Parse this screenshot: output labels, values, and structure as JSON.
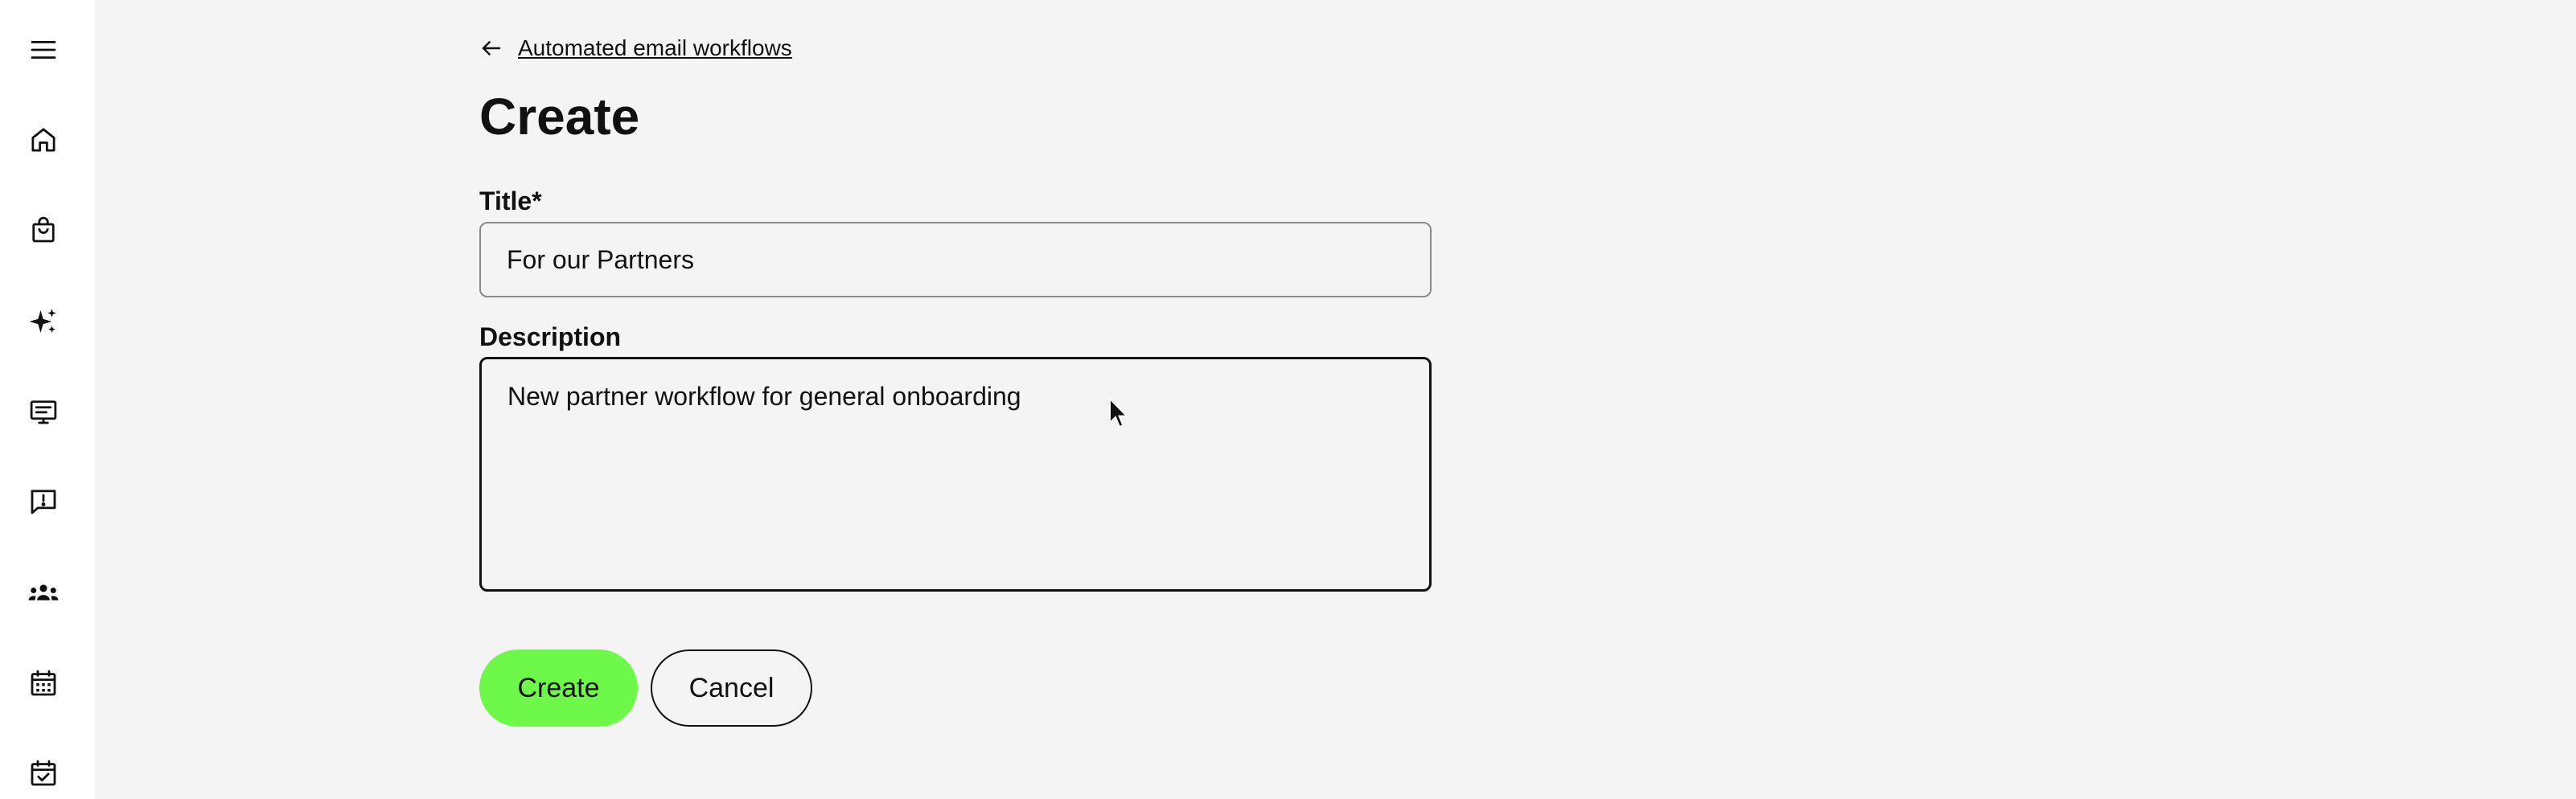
{
  "sidebar": {
    "items": [
      {
        "icon": "menu-icon"
      },
      {
        "icon": "home-icon"
      },
      {
        "icon": "shopping-bag-icon"
      },
      {
        "icon": "sparkles-icon"
      },
      {
        "icon": "display-icon"
      },
      {
        "icon": "feedback-icon"
      },
      {
        "icon": "groups-icon"
      },
      {
        "icon": "calendar-icon"
      },
      {
        "icon": "calendar-check-icon"
      }
    ]
  },
  "breadcrumb": {
    "back_label": "Automated email workflows"
  },
  "page": {
    "title": "Create"
  },
  "form": {
    "title_label": "Title",
    "title_required_marker": "*",
    "title_value": "For our Partners",
    "description_label": "Description",
    "description_value": "New partner workflow for general onboarding"
  },
  "actions": {
    "create_label": "Create",
    "cancel_label": "Cancel"
  },
  "colors": {
    "primary_button": "#6ef94a",
    "background": "#f4f4f4",
    "sidebar_background": "#ffffff"
  }
}
